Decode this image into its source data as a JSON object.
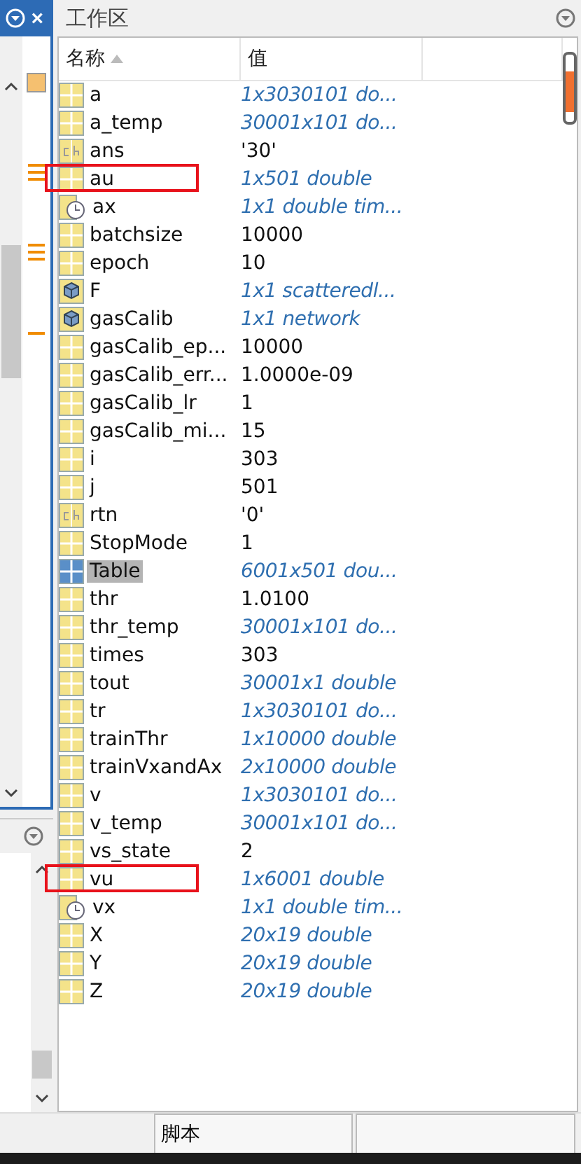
{
  "left_panel": {
    "close": "×"
  },
  "workspace": {
    "title": "工作区",
    "columns": [
      "名称",
      "值"
    ],
    "rows": [
      {
        "name": "a",
        "kind": "matrix",
        "value": "1x3030101 do...",
        "summary": true,
        "selected": false,
        "marked": false
      },
      {
        "name": "a_temp",
        "kind": "matrix",
        "value": "30001x101 do...",
        "summary": true,
        "selected": false,
        "marked": false
      },
      {
        "name": "ans",
        "kind": "char",
        "value": "'30'",
        "summary": false,
        "selected": false,
        "marked": false
      },
      {
        "name": "au",
        "kind": "matrix",
        "value": "1x501 double",
        "summary": true,
        "selected": false,
        "marked": true
      },
      {
        "name": "ax",
        "kind": "time",
        "value": "1x1 double tim...",
        "summary": true,
        "selected": false,
        "marked": false
      },
      {
        "name": "batchsize",
        "kind": "matrix",
        "value": "10000",
        "summary": false,
        "selected": false,
        "marked": false
      },
      {
        "name": "epoch",
        "kind": "matrix",
        "value": "10",
        "summary": false,
        "selected": false,
        "marked": false
      },
      {
        "name": "F",
        "kind": "object",
        "value": "1x1 scatteredl...",
        "summary": true,
        "selected": false,
        "marked": false
      },
      {
        "name": "gasCalib",
        "kind": "object",
        "value": "1x1 network",
        "summary": true,
        "selected": false,
        "marked": false
      },
      {
        "name": "gasCalib_ep...",
        "kind": "matrix",
        "value": "10000",
        "summary": false,
        "selected": false,
        "marked": false
      },
      {
        "name": "gasCalib_err...",
        "kind": "matrix",
        "value": "1.0000e-09",
        "summary": false,
        "selected": false,
        "marked": false
      },
      {
        "name": "gasCalib_lr",
        "kind": "matrix",
        "value": "1",
        "summary": false,
        "selected": false,
        "marked": false
      },
      {
        "name": "gasCalib_mi...",
        "kind": "matrix",
        "value": "15",
        "summary": false,
        "selected": false,
        "marked": false
      },
      {
        "name": "i",
        "kind": "matrix",
        "value": "303",
        "summary": false,
        "selected": false,
        "marked": false
      },
      {
        "name": "j",
        "kind": "matrix",
        "value": "501",
        "summary": false,
        "selected": false,
        "marked": false
      },
      {
        "name": "rtn",
        "kind": "char",
        "value": "'0'",
        "summary": false,
        "selected": false,
        "marked": false
      },
      {
        "name": "StopMode",
        "kind": "matrix",
        "value": "1",
        "summary": false,
        "selected": false,
        "marked": false
      },
      {
        "name": "Table",
        "kind": "matrix",
        "value": "6001x501 dou...",
        "summary": true,
        "selected": true,
        "marked": false
      },
      {
        "name": "thr",
        "kind": "matrix",
        "value": "1.0100",
        "summary": false,
        "selected": false,
        "marked": false
      },
      {
        "name": "thr_temp",
        "kind": "matrix",
        "value": "30001x101 do...",
        "summary": true,
        "selected": false,
        "marked": false
      },
      {
        "name": "times",
        "kind": "matrix",
        "value": "303",
        "summary": false,
        "selected": false,
        "marked": false
      },
      {
        "name": "tout",
        "kind": "matrix",
        "value": "30001x1 double",
        "summary": true,
        "selected": false,
        "marked": false
      },
      {
        "name": "tr",
        "kind": "matrix",
        "value": "1x3030101 do...",
        "summary": true,
        "selected": false,
        "marked": false
      },
      {
        "name": "trainThr",
        "kind": "matrix",
        "value": "1x10000 double",
        "summary": true,
        "selected": false,
        "marked": false
      },
      {
        "name": "trainVxandAx",
        "kind": "matrix",
        "value": "2x10000 double",
        "summary": true,
        "selected": false,
        "marked": false
      },
      {
        "name": "v",
        "kind": "matrix",
        "value": "1x3030101 do...",
        "summary": true,
        "selected": false,
        "marked": false
      },
      {
        "name": "v_temp",
        "kind": "matrix",
        "value": "30001x101 do...",
        "summary": true,
        "selected": false,
        "marked": false
      },
      {
        "name": "vs_state",
        "kind": "matrix",
        "value": "2",
        "summary": false,
        "selected": false,
        "marked": false
      },
      {
        "name": "vu",
        "kind": "matrix",
        "value": "1x6001 double",
        "summary": true,
        "selected": false,
        "marked": true
      },
      {
        "name": "vx",
        "kind": "time",
        "value": "1x1 double tim...",
        "summary": true,
        "selected": false,
        "marked": false
      },
      {
        "name": "X",
        "kind": "matrix",
        "value": "20x19 double",
        "summary": true,
        "selected": false,
        "marked": false
      },
      {
        "name": "Y",
        "kind": "matrix",
        "value": "20x19 double",
        "summary": true,
        "selected": false,
        "marked": false
      },
      {
        "name": "Z",
        "kind": "matrix",
        "value": "20x19 double",
        "summary": true,
        "selected": false,
        "marked": false
      }
    ]
  },
  "status_bar": [
    "脚本"
  ]
}
